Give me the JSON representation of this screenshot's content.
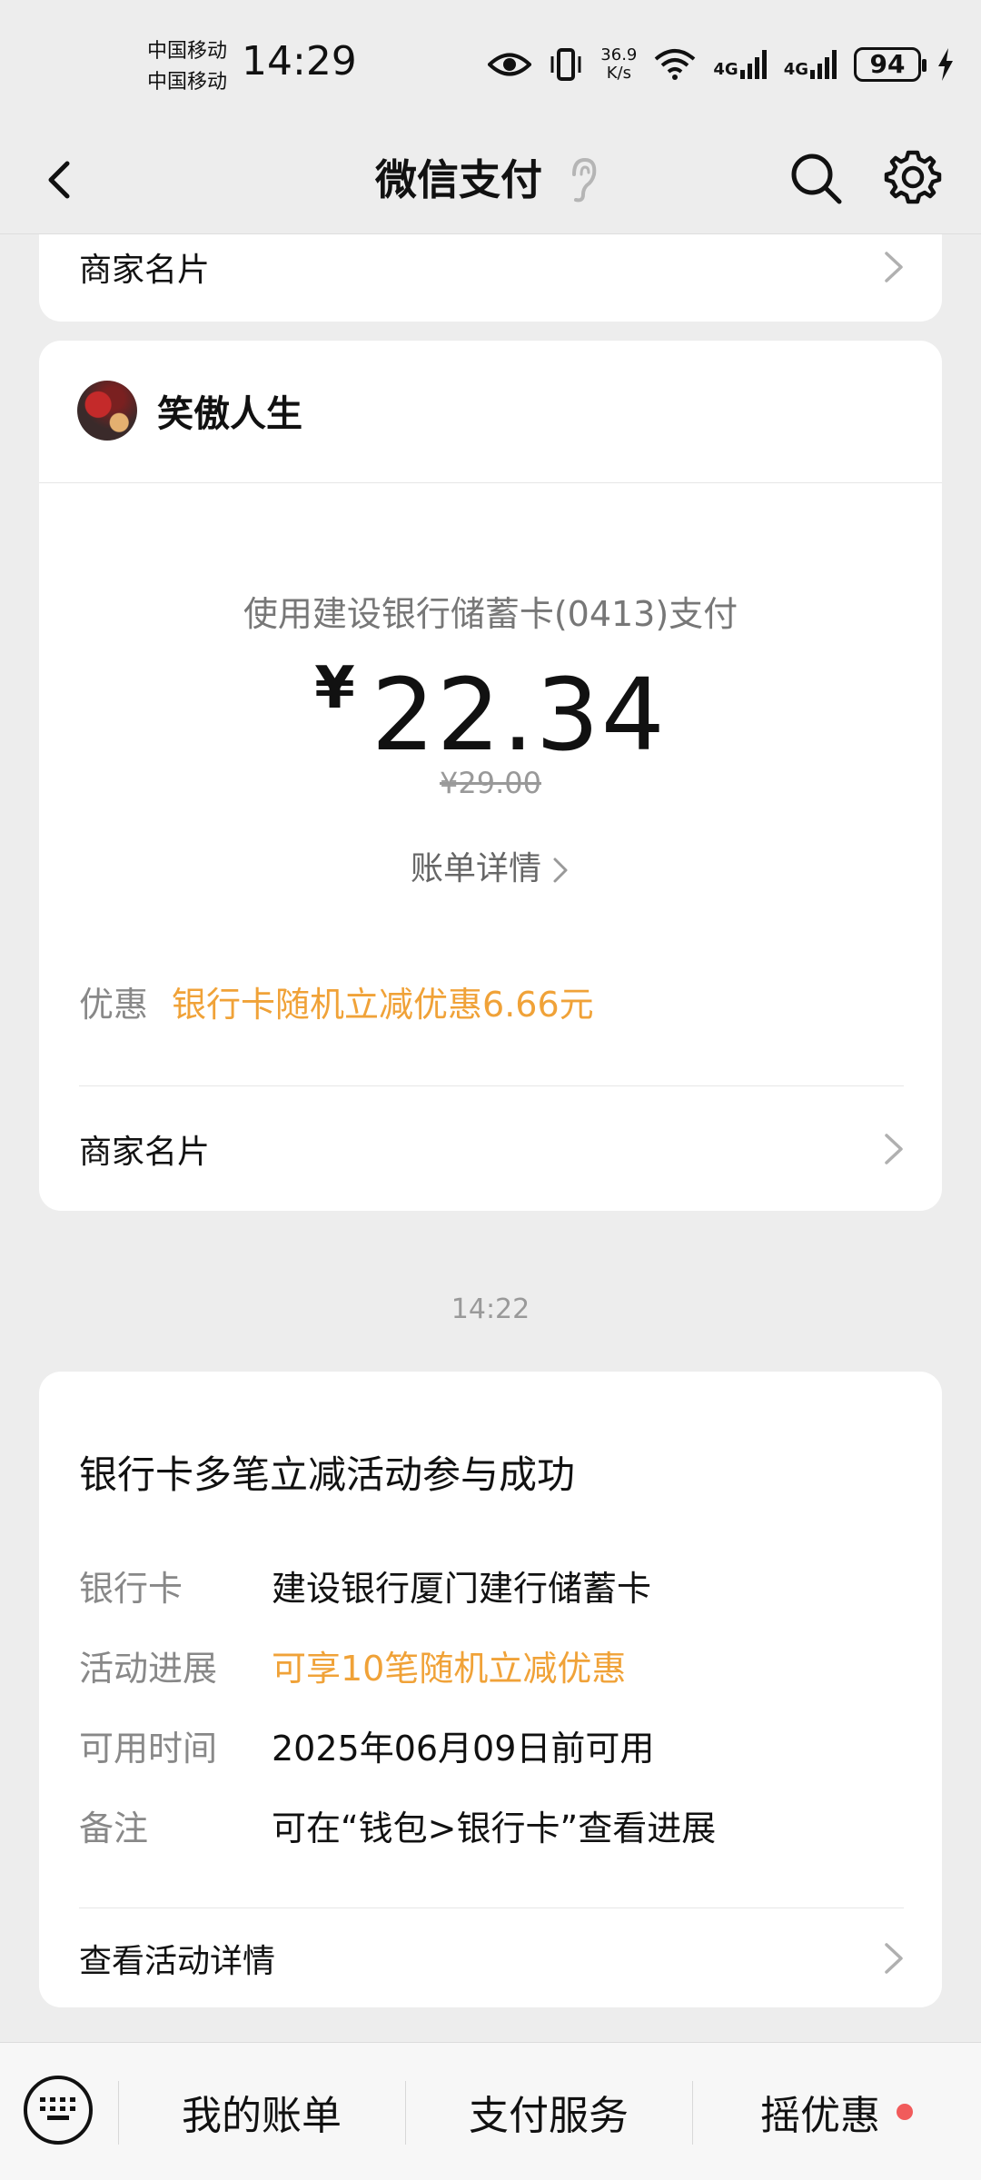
{
  "status_bar": {
    "carrier1": "中国移动",
    "carrier2": "中国移动",
    "time": "14:29",
    "speed_value": "36.9",
    "speed_unit": "K/s",
    "net1": "4G",
    "net2": "4G",
    "battery": "94"
  },
  "nav": {
    "title": "微信支付"
  },
  "top_card": {
    "merchant_card_label": "商家名片"
  },
  "payment": {
    "merchant_name": "笑傲人生",
    "method": "使用建设银行储蓄卡(0413)支付",
    "currency": "¥",
    "amount": "22.34",
    "original": "¥29.00",
    "bill_details": "账单详情",
    "promo_label": "优惠",
    "promo_value": "银行卡随机立减优惠6.66元",
    "merchant_card_label": "商家名片"
  },
  "timestamp": "14:22",
  "activity": {
    "title": "银行卡多笔立减活动参与成功",
    "rows": [
      {
        "key": "银行卡",
        "value": "建设银行厦门建行储蓄卡"
      },
      {
        "key": "活动进展",
        "value": "可享10笔随机立减优惠"
      },
      {
        "key": "可用时间",
        "value": "2025年06月09日前可用"
      },
      {
        "key": "备注",
        "value": "可在“钱包>银行卡”查看进展"
      }
    ],
    "details_link": "查看活动详情"
  },
  "bottom_bar": {
    "items": [
      "我的账单",
      "支付服务",
      "摇优惠"
    ]
  },
  "colors": {
    "accent_orange": "#f0a238",
    "badge_red": "#f15b5b",
    "background": "#ededed"
  }
}
